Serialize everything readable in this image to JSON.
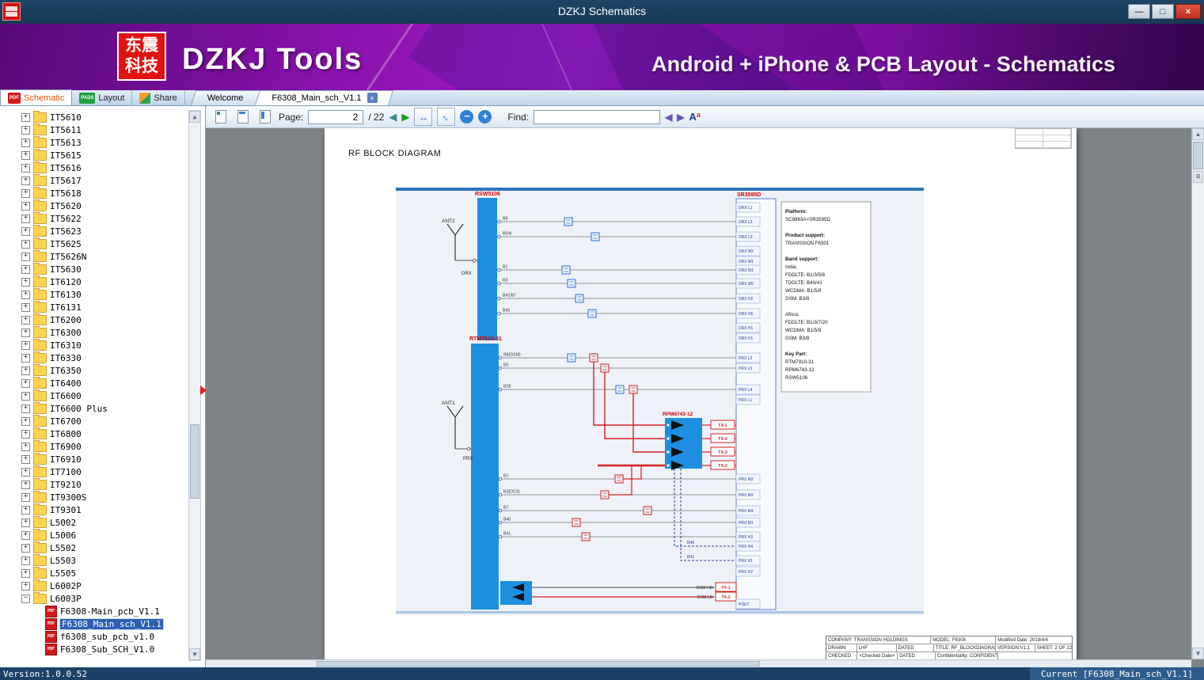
{
  "window": {
    "title": "DZKJ Schematics"
  },
  "icons": {
    "minimize": "—",
    "maximize": "□",
    "close": "×",
    "tab_close": "×",
    "prev": "◀",
    "next": "▶",
    "fit_width": "↔",
    "fit_page": "↔",
    "zoom_out": "−",
    "zoom_in": "+",
    "find_prev": "◀",
    "find_next": "▶",
    "case_big": "A",
    "case_small": "a",
    "up": "▲",
    "down": "▼",
    "menu": "≡",
    "twisty_collapsed": "+",
    "twisty_expanded": "−",
    "pdf_badge": "PDF",
    "pads_badge": "PADS"
  },
  "brand": {
    "logo_line1": "东震",
    "logo_line2": "科技",
    "app_name": "DZKJ Tools",
    "tagline": "Android + iPhone & PCB Layout - Schematics"
  },
  "app_tabs": [
    {
      "label": "Schematic"
    },
    {
      "label": "Layout"
    },
    {
      "label": "Share"
    }
  ],
  "doc_tabs": [
    {
      "label": "Welcome",
      "active": false
    },
    {
      "label": "F6308_Main_sch_V1.1",
      "active": true
    }
  ],
  "toolbar": {
    "page_label": "Page:",
    "page_value": "2",
    "page_suffix": "/ 22",
    "find_label": "Find:",
    "find_value": ""
  },
  "sidebar": {
    "folders": [
      "IT5610",
      "IT5611",
      "IT5613",
      "IT5615",
      "IT5616",
      "IT5617",
      "IT5618",
      "IT5620",
      "IT5622",
      "IT5623",
      "IT5625",
      "IT5626N",
      "IT5630",
      "IT6120",
      "IT6130",
      "IT6131",
      "IT6200",
      "IT6300",
      "IT6310",
      "IT6330",
      "IT6350",
      "IT6400",
      "IT6600",
      "IT6600 Plus",
      "IT6700",
      "IT6800",
      "IT6900",
      "IT6910",
      "IT7100",
      "IT9210",
      "IT9300S",
      "IT9301",
      "L5002",
      "L5006",
      "L5502",
      "L5503",
      "L5505",
      "L6002P"
    ],
    "expanded_folder": "L6003P",
    "files": [
      {
        "label": "F6308-Main_pcb_V1.1",
        "selected": false
      },
      {
        "label": "F6308_Main_sch_V1.1",
        "selected": true
      },
      {
        "label": "f6308_sub_pcb_v1.0",
        "selected": false
      },
      {
        "label": "F6308_Sub_SCH_V1.0",
        "selected": false
      }
    ]
  },
  "document": {
    "heading": "RF BLOCK DIAGRAM",
    "blocks": {
      "rsw": "RSW5106",
      "rtm": "RTM7910-31",
      "rpm": "RPM6743-12",
      "sr": "SR3595D"
    },
    "antennas": {
      "ant2": "ANT2",
      "ant1": "ANT1",
      "drx": "DRX",
      "prx": "PRX"
    },
    "rsw_ports": [
      "B8",
      "B5W",
      "B1",
      "B3",
      "B41/B7",
      "B40"
    ],
    "rtm_ports_upper": [
      "B8(GSM)",
      "B5",
      "B28"
    ],
    "rtm_ports_lower": [
      "B1",
      "B3(DCS)",
      "B7",
      "B40",
      "B41"
    ],
    "sr_pins": [
      "DRX L1",
      "DRX L2",
      "DRX L3",
      "DRX M3",
      "DRX M1",
      "DRX M1",
      "DRX M5",
      "DRX H2",
      "DRX H6",
      "DRX H1",
      "DRX H1",
      "PRX L2",
      "PRX L5",
      "PRX L4",
      "PRX L1",
      "PRX M2",
      "PRX M3",
      "PRX M4",
      "PRX M1",
      "PRX H3",
      "PRX H4",
      "PRX H1",
      "PRX H2",
      "POET"
    ],
    "tx_labels": [
      "TX-1",
      "TX-4",
      "TX-3",
      "TX-2"
    ],
    "dashed_labels": [
      "B40",
      "B41"
    ],
    "gsm_rows": [
      {
        "label": "GSM HB-",
        "tx": "TX-1"
      },
      {
        "label": "GSM LB-",
        "tx": "TX-2"
      }
    ],
    "info_box": {
      "lines": [
        {
          "text": "Platform:",
          "bold": true
        },
        {
          "text": "SC9863A+SR3595D"
        },
        {
          "text": ""
        },
        {
          "text": "Product support:",
          "bold": true
        },
        {
          "text": "TRANSSION F6301"
        },
        {
          "text": ""
        },
        {
          "text": "Band support:",
          "bold": true
        },
        {
          "text": "India:"
        },
        {
          "text": "FDDLTE: B1/3/5/8"
        },
        {
          "text": "TDDLTE: B40/41"
        },
        {
          "text": "WCDMA: B1/5/8"
        },
        {
          "text": "GSM: B3/8"
        },
        {
          "text": ""
        },
        {
          "text": "Africa:"
        },
        {
          "text": "FDDLTE: B1/3/7/20"
        },
        {
          "text": "WCDMA: B1/5/8"
        },
        {
          "text": "GSM: B3/8"
        },
        {
          "text": ""
        },
        {
          "text": "Key Part:",
          "bold": true
        },
        {
          "text": "RTM7910-31"
        },
        {
          "text": "RPM6743-12"
        },
        {
          "text": "RSW5106"
        }
      ]
    },
    "title_block": {
      "company": "COMPANY: TRANSSION HOLDINGS",
      "model": "MODEL: F6308",
      "modified": "Modified Date: 2019/4/4",
      "drawn": "DRAWN",
      "drawn_name": "LHF",
      "dated1": "DATED",
      "title": "TITLE: RF_BLOCKDIAGRAM",
      "version": "VERSION:V1.1",
      "sheet": "SHEET: 2 OF 22",
      "checked": "CHECKED",
      "checked_value": "<Checked Date>",
      "dated2": "DATED",
      "confidentiality": "Confidentiality: CONFIDENTIAL"
    }
  },
  "status_bar": {
    "left": "Version:1.0.0.52",
    "right": "Current [F6308_Main_sch_V1.1]"
  }
}
